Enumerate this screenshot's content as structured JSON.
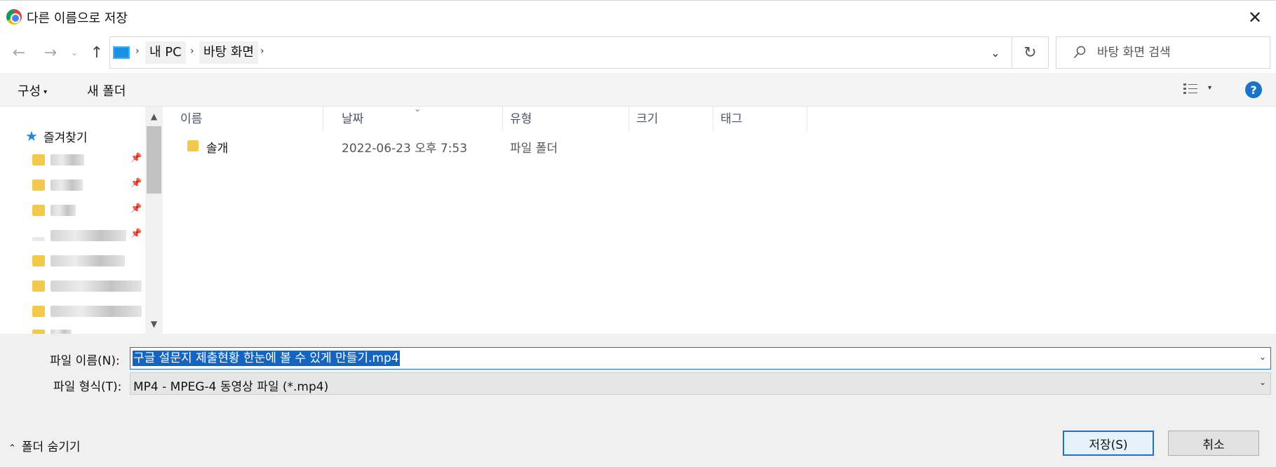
{
  "window": {
    "title": "다른 이름으로 저장",
    "close_glyph": "✕"
  },
  "nav": {
    "back_glyph": "←",
    "forward_glyph": "→",
    "recent_glyph": "⌄",
    "up_glyph": "↑"
  },
  "address": {
    "crumbs": [
      "내 PC",
      "바탕 화면"
    ],
    "separator": "›",
    "dropdown_glyph": "⌄",
    "refresh_glyph": "↻"
  },
  "search": {
    "placeholder": "바탕 화면 검색"
  },
  "toolbar": {
    "organize_label": "구성",
    "organize_caret": "▾",
    "new_folder_label": "새 폴더",
    "view_caret": "▾",
    "help_glyph": "?"
  },
  "nav_pane": {
    "favorites_label": "즐겨찾기",
    "star_glyph": "★",
    "pin_glyph": "📌",
    "scroll_up_glyph": "▲",
    "scroll_down_glyph": "▼"
  },
  "columns": {
    "name": "이름",
    "date": "날짜",
    "type": "유형",
    "size": "크기",
    "tags": "태그",
    "sort_glyph": "⌄"
  },
  "files": [
    {
      "name": "솔개",
      "date": "2022-06-23 오후 7:53",
      "type": "파일 폴더"
    }
  ],
  "save": {
    "filename_label": "파일 이름(N):",
    "filename_value": "구글 설문지 제출현황 한눈에 볼 수 있게 만들기.mp4",
    "filetype_label": "파일 형식(T):",
    "filetype_value": "MP4 - MPEG-4 동영상 파일 (*.mp4)",
    "dropdown_glyph": "⌄",
    "hide_folders_label": "폴더 숨기기",
    "hide_folders_glyph": "⌃",
    "save_button": "저장(S)",
    "cancel_button": "취소"
  },
  "colors": {
    "accent": "#1e6fd9",
    "selection": "#1565c0",
    "folder": "#f2c94c"
  }
}
